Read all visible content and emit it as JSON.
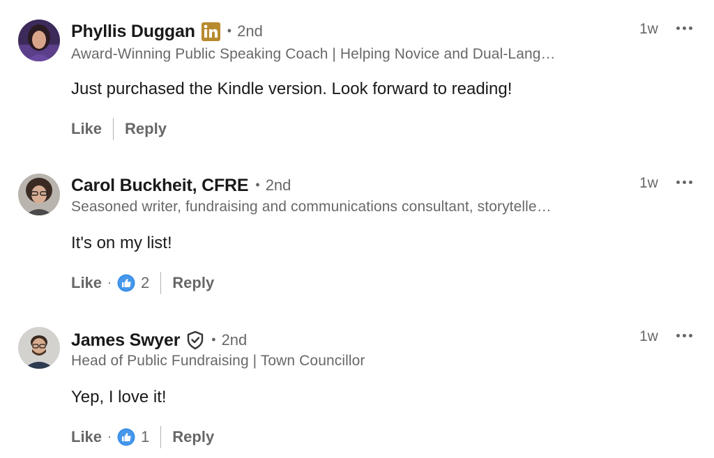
{
  "colors": {
    "linkedin_badge": "#b88a2f",
    "like_blue": "#378fe9",
    "text_primary": "#191919",
    "text_secondary": "#666666"
  },
  "comments": [
    {
      "name": "Phyllis Duggan",
      "badge": "linkedin-icon",
      "degree_sep": "•",
      "degree": "2nd",
      "headline": "Award-Winning Public Speaking Coach | Helping Novice and Dual-Lang…",
      "time": "1w",
      "more_icon": "more-options-icon",
      "text": "Just purchased the Kindle version. Look forward to reading!",
      "like_label": "Like",
      "reply_label": "Reply"
    },
    {
      "name": "Carol Buckheit, CFRE",
      "degree_sep": "•",
      "degree": "2nd",
      "headline": "Seasoned writer, fundraising and communications consultant, storytelle…",
      "time": "1w",
      "more_icon": "more-options-icon",
      "text": "It's on my list!",
      "like_label": "Like",
      "reaction_sep": "·",
      "reaction_icon": "like-reaction-icon",
      "reaction_count": "2",
      "reply_label": "Reply"
    },
    {
      "name": "James Swyer",
      "badge": "verified-shield-icon",
      "degree_sep": "•",
      "degree": "2nd",
      "headline": "Head of Public Fundraising | Town Councillor",
      "time": "1w",
      "more_icon": "more-options-icon",
      "text": "Yep, I love it!",
      "like_label": "Like",
      "reaction_sep": "·",
      "reaction_icon": "like-reaction-icon",
      "reaction_count": "1",
      "reply_label": "Reply"
    }
  ]
}
